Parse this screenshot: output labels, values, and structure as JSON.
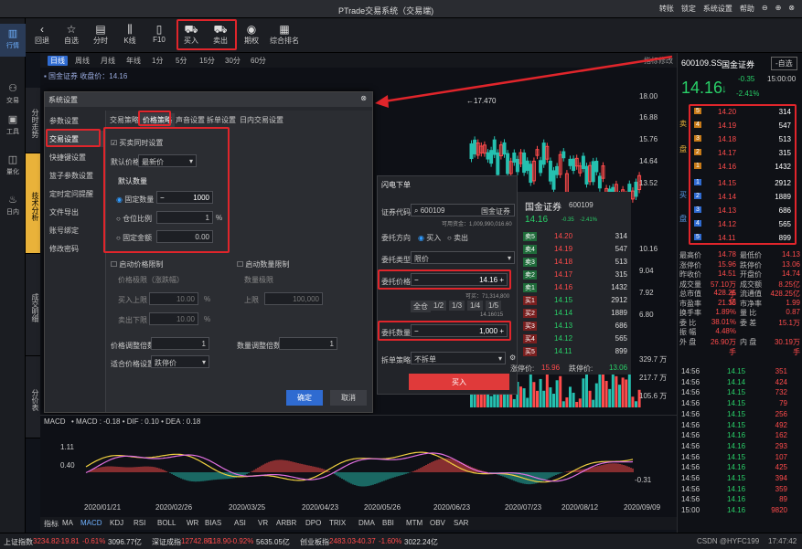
{
  "window": {
    "title": "PTrade交易系统（交易端)",
    "right": [
      "转账",
      "锁定",
      "系统设置",
      "帮助"
    ]
  },
  "leftnav": [
    {
      "label": "行情",
      "icon": "chart-icon"
    },
    {
      "label": "交易",
      "icon": "trade-icon"
    },
    {
      "label": "工具",
      "icon": "tools-icon"
    },
    {
      "label": "量化",
      "icon": "quant-icon"
    },
    {
      "label": "日内",
      "icon": "intraday-icon"
    }
  ],
  "vtabs": [
    "分时走势",
    "技术分析",
    "成交明细",
    "分价表"
  ],
  "toolbar": [
    {
      "label": "回退",
      "icon": "back-icon"
    },
    {
      "label": "自选",
      "icon": "star-icon"
    },
    {
      "label": "分时",
      "icon": "timeshare-icon"
    },
    {
      "label": "K线",
      "icon": "kline-icon"
    },
    {
      "label": "F10",
      "icon": "doc-icon"
    },
    {
      "label": "买入",
      "icon": "cart-icon"
    },
    {
      "label": "卖出",
      "icon": "cart-icon"
    },
    {
      "label": "期权",
      "icon": "option-icon"
    },
    {
      "label": "综合排名",
      "icon": "rank-icon"
    }
  ],
  "periods": [
    "日线",
    "周线",
    "月线",
    "年线",
    "1分",
    "5分",
    "15分",
    "30分",
    "60分"
  ],
  "periods_right": "指标修改",
  "chart_info": "▪ 国金证券 收盘价：14.16",
  "price_axis": [
    "18.00",
    "16.88",
    "15.76",
    "14.64",
    "13.52",
    "10.16",
    "9.04",
    "7.92",
    "6.80"
  ],
  "peak_label": "←17.470",
  "vol_axis": [
    "329.7 万",
    "217.7 万",
    "105.6 万"
  ],
  "dialog": {
    "title": "系统设置",
    "sidebar": [
      "参数设置",
      "交易设置",
      "快捷键设置",
      "篮子参数设置",
      "定时定问提醒",
      "文件导出",
      "账号绑定",
      "修改密码"
    ],
    "tabs": [
      "交易策略",
      "价格策略",
      "声音设置",
      "拆单设置",
      "日内交易设置"
    ],
    "cb_default": "买卖同时设置",
    "default_price_label": "默认价格",
    "default_price_value": "最新价",
    "qty_group": "默认数量",
    "fixed_qty": "固定数量",
    "fixed_qty_val": "1000",
    "position_ratio": "仓位比例",
    "position_ratio_val": "1",
    "pct": "%",
    "fixed_amount": "固定金额",
    "fixed_amount_val": "0.00",
    "cb_price_limit": "启动价格限制",
    "price_limit_sub": "价格极限（涨跌幅）",
    "buy_limit": "买入上限",
    "buy_val": "10.00",
    "sell_limit": "卖出下限",
    "sell_val": "10.00",
    "cb_qty_limit": "启动数量限制",
    "qty_limit_sub": "数量极限",
    "upper": "上限",
    "upper_val": "100,000",
    "price_adj": "价格调整倍数",
    "price_adj_val": "1",
    "qty_adj": "数量调整倍数",
    "qty_adj_val": "1",
    "adapt_label": "适合价格设置",
    "adapt_val": "跌停价",
    "ok": "确定",
    "cancel": "取消"
  },
  "flash": {
    "title": "闪电下单",
    "code_label": "证券代码",
    "code": "600109",
    "name": "国金证券",
    "avail": "可用资金：1,009,990,016.60",
    "dir_label": "委托方向",
    "buy": "买入",
    "sell": "卖出",
    "type_label": "委托类型",
    "type_val": "限价",
    "price_label": "委托价格",
    "price": "14.16",
    "bounds": "可买：71,314,800",
    "bounds2": "14.16015",
    "fracs": [
      "全仓",
      "1/2",
      "1/3",
      "1/4",
      "1/5"
    ],
    "qty_label": "委托数量",
    "qty": "1,000",
    "split_label": "拆单策略",
    "split_val": "不拆单",
    "submit": "买入"
  },
  "flash2": {
    "name": "国金证券",
    "code": "600109",
    "price": "14.16",
    "chg": "-0.35",
    "pct": "-2.41%",
    "asks": [
      [
        "卖5",
        "14.20",
        "314"
      ],
      [
        "卖4",
        "14.19",
        "547"
      ],
      [
        "卖3",
        "14.18",
        "513"
      ],
      [
        "卖2",
        "14.17",
        "315"
      ],
      [
        "卖1",
        "14.16",
        "1432"
      ]
    ],
    "bids": [
      [
        "买1",
        "14.15",
        "2912"
      ],
      [
        "买2",
        "14.14",
        "1889"
      ],
      [
        "买3",
        "14.13",
        "686"
      ],
      [
        "买4",
        "14.12",
        "565"
      ],
      [
        "买5",
        "14.11",
        "899"
      ]
    ],
    "limit_up_label": "涨停价:",
    "limit_up": "15.96",
    "limit_dn_label": "跌停价:",
    "limit_dn": "13.06"
  },
  "right": {
    "code": "600109.SS",
    "name": "国金证券",
    "btn": "-自选",
    "price": "14.16",
    "arrow": "↓",
    "chg": "-0.35",
    "pct": "-2.41%",
    "time": "15:00:00",
    "asks": [
      [
        "5",
        "14.20",
        "314"
      ],
      [
        "4",
        "14.19",
        "547"
      ],
      [
        "3",
        "14.18",
        "513"
      ],
      [
        "2",
        "14.17",
        "315"
      ],
      [
        "1",
        "14.16",
        "1432"
      ]
    ],
    "bids": [
      [
        "1",
        "14.15",
        "2912"
      ],
      [
        "2",
        "14.14",
        "1889"
      ],
      [
        "3",
        "14.13",
        "686"
      ],
      [
        "4",
        "14.12",
        "565"
      ],
      [
        "5",
        "14.11",
        "899"
      ]
    ],
    "stats": [
      [
        "最高价",
        "14.78",
        "最低价",
        "14.13"
      ],
      [
        "涨停价",
        "15.96",
        "跌停价",
        "13.06"
      ],
      [
        "昨收价",
        "14.51",
        "开盘价",
        "14.74"
      ],
      [
        "成交量",
        "57.10万手",
        "成交额",
        "8.25亿"
      ],
      [
        "总市值",
        "428.25亿",
        "流通值",
        "428.25亿"
      ],
      [
        "市盈率",
        "21.38",
        "市净率",
        "1.99"
      ],
      [
        "换手率",
        "1.89%",
        "量 比",
        "0.87"
      ],
      [
        "委 比",
        "38.01%",
        "委 差",
        "15.1万"
      ],
      [
        "振 幅",
        "4.48%",
        "",
        ""
      ],
      [
        "外 盘",
        "26.90万手",
        "内 盘",
        "30.19万手"
      ]
    ],
    "trades": [
      [
        "14:56",
        "14.15",
        "351"
      ],
      [
        "14:56",
        "14.14",
        "424"
      ],
      [
        "14:56",
        "14.15",
        "732"
      ],
      [
        "14:56",
        "14.15",
        "79"
      ],
      [
        "14:56",
        "14.15",
        "256"
      ],
      [
        "14:56",
        "14.15",
        "492"
      ],
      [
        "14:56",
        "14.16",
        "162"
      ],
      [
        "14:56",
        "14.16",
        "293"
      ],
      [
        "14:56",
        "14.15",
        "107"
      ],
      [
        "14:56",
        "14.16",
        "425"
      ],
      [
        "14:56",
        "14.15",
        "394"
      ],
      [
        "14:56",
        "14.16",
        "359"
      ],
      [
        "14:56",
        "14.16",
        "89"
      ],
      [
        "15:00",
        "14.16",
        "9820"
      ]
    ]
  },
  "macd": {
    "label": "MACD",
    "info": "• MACD : -0.18 • DIF : 0.10 • DEA : 0.18",
    "axis": [
      "1.11",
      "0.40",
      "-0.31"
    ],
    "dates": [
      "2020/01/21",
      "2020/02/26",
      "2020/03/25",
      "2020/04/23",
      "2020/05/26",
      "2020/06/23",
      "2020/07/23",
      "2020/08/12",
      "2020/09/09"
    ]
  },
  "indicators": [
    "指标",
    "MA",
    "MACD",
    "KDJ",
    "RSI",
    "BOLL",
    "WR",
    "BIAS",
    "ASI",
    "VR",
    "ARBR",
    "DPO",
    "TRIX",
    "DMA",
    "BBI",
    "MTM",
    "OBV",
    "SAR"
  ],
  "status": [
    [
      "上证指数",
      "3234.82",
      "-19.81",
      "-0.61%",
      "3096.77亿"
    ],
    [
      "深证成指",
      "12742.85",
      "-118.90",
      "-0.92%",
      "5635.05亿"
    ],
    [
      "创业板指",
      "2483.03",
      "-40.37",
      "-1.60%",
      "3022.24亿"
    ]
  ],
  "watermark": "CSDN @HYFC199",
  "clock": "17:47:42"
}
